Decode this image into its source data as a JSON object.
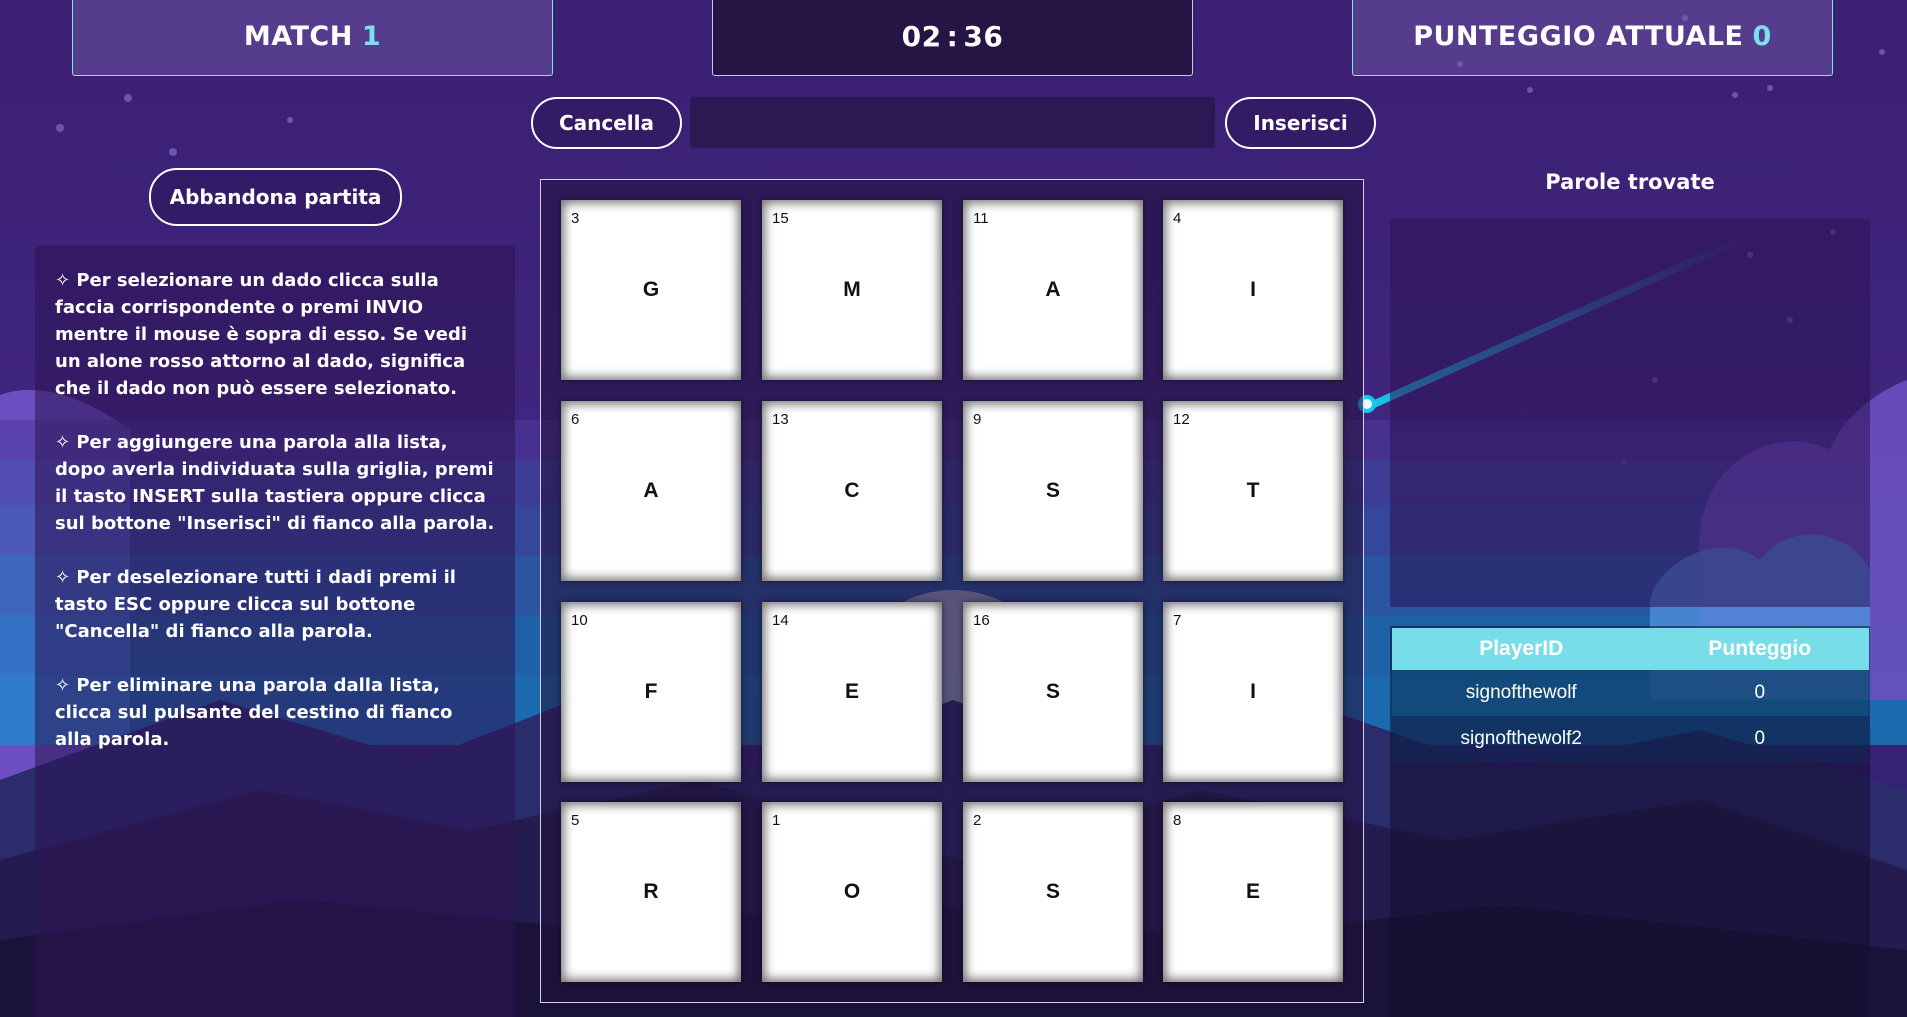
{
  "header": {
    "match_label": "MATCH",
    "match_number": "1",
    "timer_minutes": "02",
    "timer_separator": ":",
    "timer_seconds": "36",
    "score_label": "PUNTEGGIO ATTUALE",
    "score_value": "0"
  },
  "controls": {
    "cancel_label": "Cancella",
    "insert_label": "Inserisci",
    "word_value": "",
    "abandon_label": "Abbandona partita"
  },
  "instructions": [
    "✧ Per selezionare un dado clicca sulla faccia corrispondente o premi INVIO mentre il mouse è sopra di esso. Se vedi un alone rosso attorno al dado, significa che il dado non può essere selezionato.",
    "✧ Per aggiungere una parola alla lista, dopo averla individuata sulla griglia, premi il tasto INSERT sulla tastiera oppure clicca sul bottone \"Inserisci\" di fianco alla parola.",
    "✧ Per deselezionare tutti i dadi premi il tasto ESC oppure clicca sul bottone \"Cancella\" di fianco alla parola.",
    "✧ Per eliminare una parola dalla lista, clicca sul pulsante del cestino di fianco alla parola."
  ],
  "board": {
    "dice": [
      {
        "number": "3",
        "letter": "G"
      },
      {
        "number": "15",
        "letter": "M"
      },
      {
        "number": "11",
        "letter": "A"
      },
      {
        "number": "4",
        "letter": "I"
      },
      {
        "number": "6",
        "letter": "A"
      },
      {
        "number": "13",
        "letter": "C"
      },
      {
        "number": "9",
        "letter": "S"
      },
      {
        "number": "12",
        "letter": "T"
      },
      {
        "number": "10",
        "letter": "F"
      },
      {
        "number": "14",
        "letter": "E"
      },
      {
        "number": "16",
        "letter": "S"
      },
      {
        "number": "7",
        "letter": "I"
      },
      {
        "number": "5",
        "letter": "R"
      },
      {
        "number": "1",
        "letter": "O"
      },
      {
        "number": "2",
        "letter": "S"
      },
      {
        "number": "8",
        "letter": "E"
      }
    ]
  },
  "found_words": {
    "title": "Parole trovate",
    "words": []
  },
  "scoreboard": {
    "headers": [
      "PlayerID",
      "Punteggio"
    ],
    "rows": [
      {
        "player": "signofthewolf",
        "score": "0"
      },
      {
        "player": "signofthewolf2",
        "score": "0"
      }
    ]
  },
  "colors": {
    "accent": "#7ee0ef",
    "table_header": "#77dde8",
    "background": "#3b2277"
  }
}
